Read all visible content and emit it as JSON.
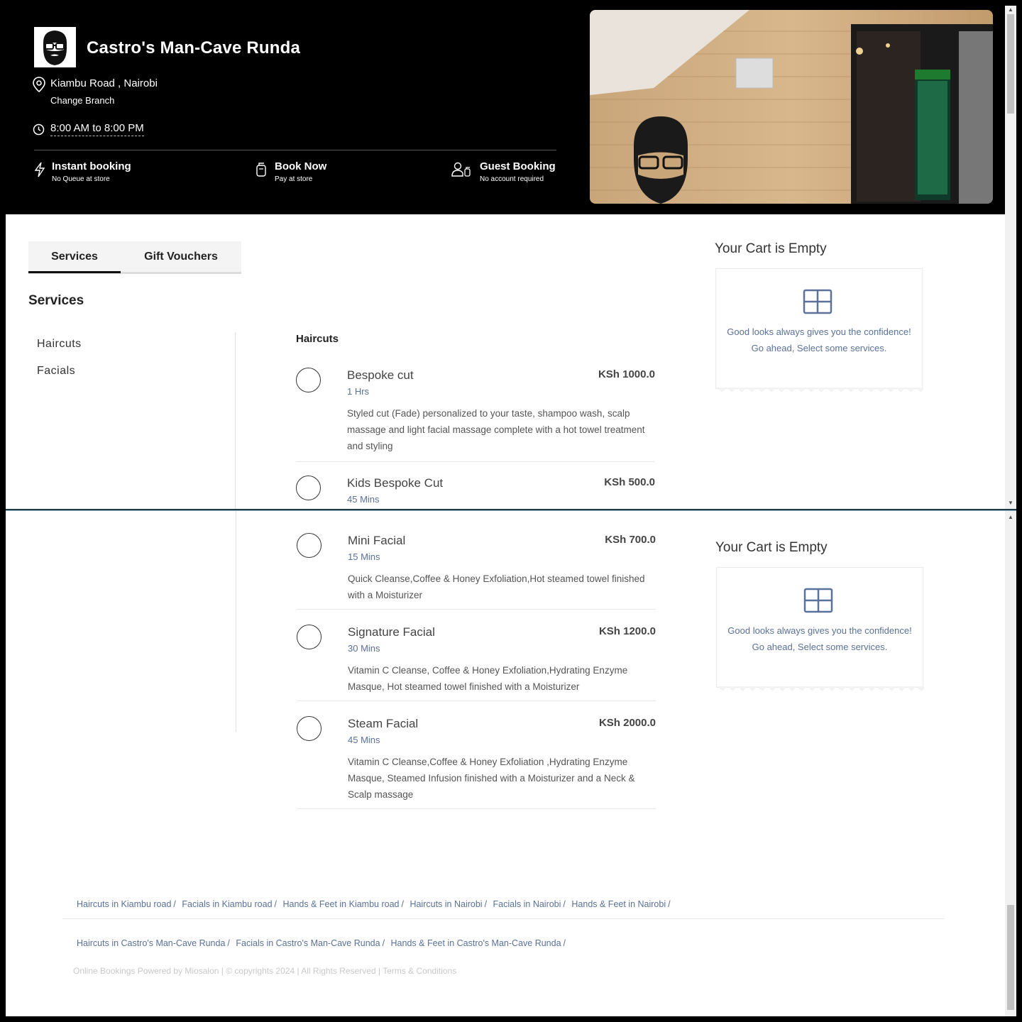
{
  "shop": {
    "name": "Castro's Man-Cave Runda",
    "location": "Kiambu Road , Nairobi",
    "change_branch": "Change Branch",
    "hours": "8:00 AM to 8:00 PM"
  },
  "features": [
    {
      "title": "Instant booking",
      "sub": "No Queue at store",
      "icon": "lightning-icon"
    },
    {
      "title": "Book Now",
      "sub": "Pay at store",
      "icon": "cash-icon"
    },
    {
      "title": "Guest Booking",
      "sub": "No account required",
      "icon": "guest-icon"
    }
  ],
  "tabs": [
    {
      "label": "Services",
      "active": true
    },
    {
      "label": "Gift Vouchers",
      "active": false
    }
  ],
  "services_heading": "Services",
  "categories": [
    "Haircuts",
    "Facials"
  ],
  "haircuts": {
    "heading": "Haircuts",
    "items": [
      {
        "name": "Bespoke cut",
        "duration": "1 Hrs",
        "price": "KSh 1000.0",
        "description": "Styled cut (Fade) personalized to your taste, shampoo wash, scalp massage and light facial massage complete with a hot towel treatment and styling"
      },
      {
        "name": "Kids Bespoke Cut",
        "duration": "45 Mins",
        "price": "KSh 500.0",
        "description": ""
      }
    ]
  },
  "facials": {
    "items": [
      {
        "name": "Mini Facial",
        "duration": "15 Mins",
        "price": "KSh 700.0",
        "description": "Quick Cleanse,Coffee & Honey Exfoliation,Hot steamed towel finished with a Moisturizer"
      },
      {
        "name": "Signature Facial",
        "duration": "30 Mins",
        "price": "KSh 1200.0",
        "description": "Vitamin C Cleanse, Coffee & Honey Exfoliation,Hydrating Enzyme Masque, Hot steamed towel finished with a Moisturizer"
      },
      {
        "name": "Steam Facial",
        "duration": "45 Mins",
        "price": "KSh 2000.0",
        "description": "Vitamin C Cleanse,Coffee & Honey Exfoliation ,Hydrating Enzyme Masque, Steamed Infusion finished with a Moisturizer and a Neck & Scalp massage"
      }
    ]
  },
  "cart": {
    "title": "Your Cart is Empty",
    "line1": "Good looks always gives you the confidence!",
    "line2": "Go ahead, Select some services."
  },
  "footer": {
    "row1": [
      "Haircuts in Kiambu road",
      "Facials in Kiambu road",
      "Hands & Feet in Kiambu road",
      "Haircuts in Nairobi",
      "Facials in Nairobi",
      "Hands & Feet in Nairobi"
    ],
    "row2": [
      "Haircuts in Castro's Man-Cave Runda",
      "Facials in Castro's Man-Cave Runda",
      "Hands & Feet in Castro's Man-Cave Runda"
    ],
    "copyright": "Online Bookings Powered by Miosalon | © copyrights 2024 | All Rights Reserved | Terms & Conditions"
  },
  "colors": {
    "accent_text": "#5a7199",
    "hero_bg": "#000000"
  }
}
